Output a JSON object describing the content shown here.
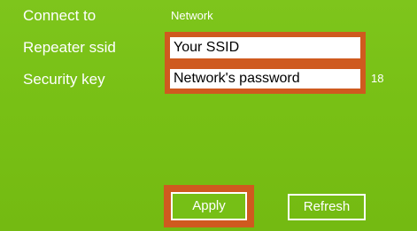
{
  "form": {
    "connect_to": {
      "label": "Connect to",
      "value": "Network"
    },
    "repeater_ssid": {
      "label": "Repeater ssid",
      "value": "Your SSID"
    },
    "security_key": {
      "label": "Security key",
      "value": "Network's password",
      "length": "18"
    }
  },
  "actions": {
    "apply_label": "Apply",
    "refresh_label": "Refresh"
  },
  "colors": {
    "panel_background": "#78c015",
    "highlight_outline": "#cf5a1f",
    "text": "#ffffff"
  }
}
